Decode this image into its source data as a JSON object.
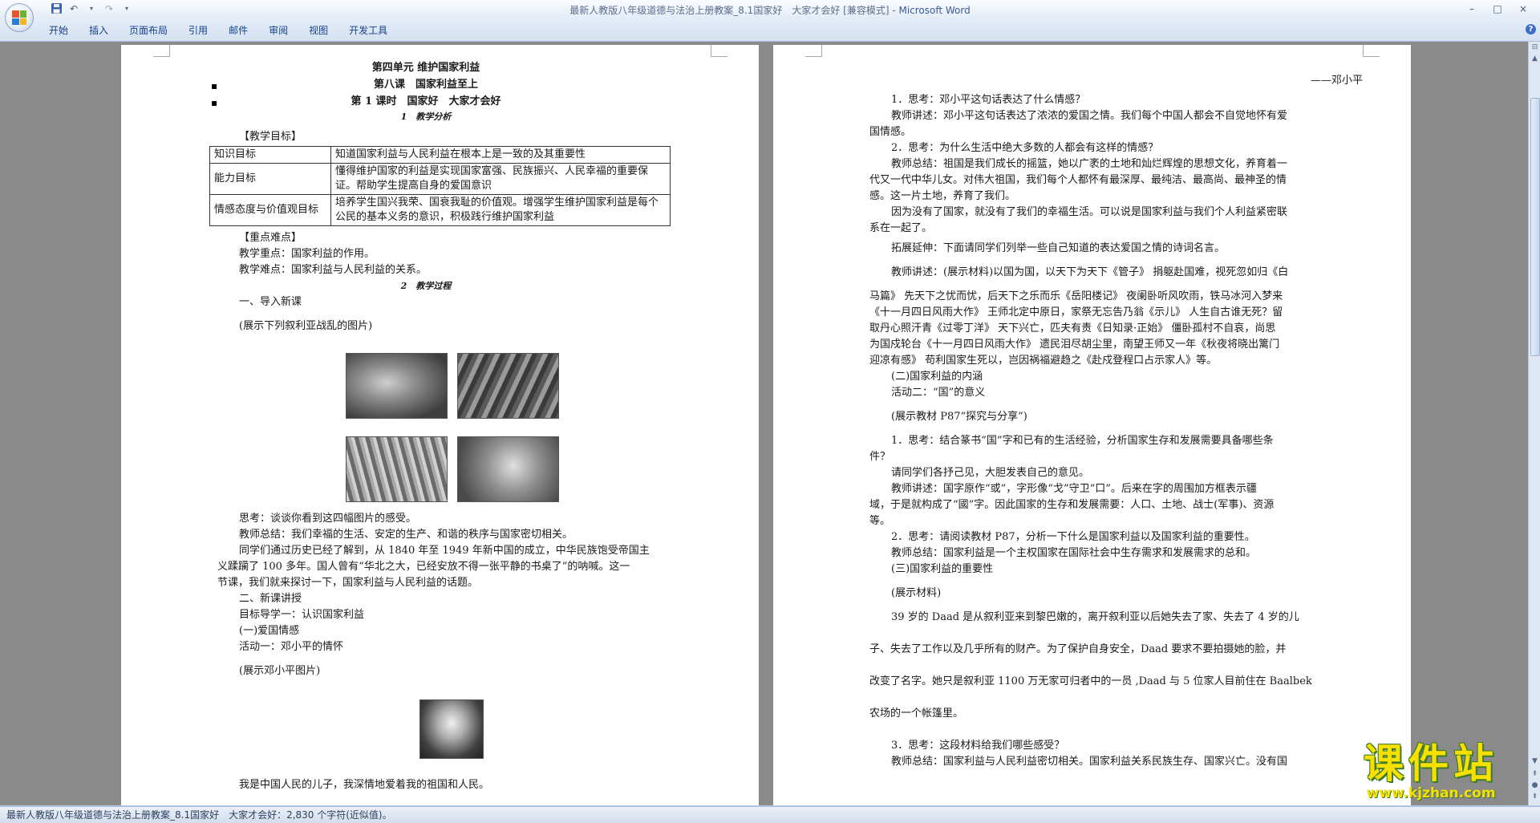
{
  "window": {
    "title": "最新人教版八年级道德与法治上册教案_8.1国家好　大家才会好 [兼容模式] - ",
    "app": "Microsoft Word",
    "controls": [
      "–",
      "□",
      "×"
    ]
  },
  "ribbon": {
    "tabs": [
      "开始",
      "插入",
      "页面布局",
      "引用",
      "邮件",
      "审阅",
      "视图",
      "开发工具"
    ],
    "help": "?"
  },
  "left_page": {
    "unit_title": "第四单元 维护国家利益",
    "lesson_title": "第八课　国家利益至上",
    "period_title": "第 1 课时　国家好　大家才会好",
    "section1": "1　教学分析",
    "goals_heading": "【教学目标】",
    "goals_table": [
      {
        "key": "知识目标",
        "value": "知道国家利益与人民利益在根本上是一致的及其重要性"
      },
      {
        "key": "能力目标",
        "value": "懂得维护国家的利益是实现国家富强、民族振兴、人民幸福的重要保证。帮助学生提高自身的爱国意识"
      },
      {
        "key": "情感态度与价值观目标",
        "value": "培养学生国兴我荣、国衰我耻的价值观。增强学生维护国家利益是每个公民的基本义务的意识，积极践行维护国家利益"
      }
    ],
    "key_heading": "【重点难点】",
    "key_point": "教学重点：国家利益的作用。",
    "difficult_point": "教学难点：国家利益与人民利益的关系。",
    "section2": "2　教学过程",
    "intro": "一、导入新课",
    "show_pics": "(展示下列叙利亚战乱的图片)",
    "think": "思考：谈谈你看到这四幅图片的感受。",
    "teacher_summary": "教师总结：我们幸福的生活、安定的生产、和谐的秩序与国家密切相关。",
    "para_lines": [
      "同学们通过历史已经了解到，从 1840 年至 1949 年新中国的成立，中华民族饱受帝国主",
      "义蹂躏了 100 多年。国人曾有“华北之大，已经安放不得一张平静的书桌了”的呐喊。这一",
      "节课，我们就来探讨一下，国家利益与人民利益的话题。"
    ],
    "new_lesson": "二、新课讲授",
    "goal_guide": "目标导学一：认识国家利益",
    "patriot": "(一)爱国情感",
    "activity1": "活动一：邓小平的情怀",
    "show_deng": "(展示邓小平图片)",
    "quote": "我是中国人民的儿子，我深情地爱着我的祖国和人民。"
  },
  "right_page": {
    "signature": "——邓小平",
    "lines": [
      "1．思考：邓小平这句话表达了什么情感？",
      "教师讲述：邓小平这句话表达了浓浓的爱国之情。我们每个中国人都会不自觉地怀有爱",
      "国情感。",
      "2．思考：为什么生活中绝大多数的人都会有这样的情感？",
      "教师总结：祖国是我们成长的摇篮，她以广袤的土地和灿烂辉煌的思想文化，养育着一",
      "代又一代中华儿女。对伟大祖国，我们每个人都怀有最深厚、最纯洁、最高尚、最神圣的情",
      "感。这一片土地，养育了我们。",
      "因为没有了国家，就没有了我们的幸福生活。可以说是国家利益与我们个人利益紧密联",
      "系在一起了。",
      "拓展延伸：下面请同学们列举一些自己知道的表达爱国之情的诗词名言。",
      "教师讲述：(展示材料)以国为国，以天下为天下《管子》 捐躯赴国难，视死忽如归《白",
      "马篇》 先天下之忧而忧，后天下之乐而乐《岳阳楼记》 夜阑卧听风吹雨，铁马冰河入梦来",
      "《十一月四日风雨大作》 王师北定中原日，家祭无忘告乃翁《示儿》 人生自古谁无死？留",
      "取丹心照汗青《过零丁洋》 天下兴亡，匹夫有责《日知录·正始》 僵卧孤村不自哀，尚思",
      "为国戍轮台《十一月四日风雨大作》 遗民泪尽胡尘里，南望王师又一年《秋夜将晓出篱门",
      "迎凉有感》 苟利国家生死以，岂因祸福避趋之《赴戍登程口占示家人》等。",
      "(二)国家利益的内涵",
      "活动二：“国”的意义",
      "(展示教材 P87“探究与分享”)",
      "1．思考：结合篆书“国”字和已有的生活经验，分析国家生存和发展需要具备哪些条",
      "件？",
      "请同学们各抒己见，大胆发表自己的意见。",
      "教师讲述：国字原作“或”，字形像“戈”守卫“口”。后来在字的周围加方框表示疆",
      "域，于是就构成了“國”字。因此国家的生存和发展需要：人口、土地、战士(军事)、资源",
      "等。",
      "2．思考：请阅读教材 P87，分析一下什么是国家利益以及国家利益的重要性。",
      "教师总结：国家利益是一个主权国家在国际社会中生存需求和发展需求的总和。",
      "(三)国家利益的重要性",
      "(展示材料)",
      "39 岁的 Daad 是从叙利亚来到黎巴嫩的，离开叙利亚以后她失去了家、失去了 4 岁的儿",
      "子、失去了工作以及几乎所有的财产。为了保护自身安全，Daad 要求不要拍摄她的脸，并",
      "改变了名字。她只是叙利亚 1100 万无家可归者中的一员 ,Daad 与 5 位家人目前住在 Baalbek",
      "农场的一个帐篷里。",
      "3．思考：这段材料给我们哪些感受？",
      "教师总结：国家利益与人民利益密切相关。国家利益关系民族生存、国家兴亡。没有国"
    ]
  },
  "statusbar": {
    "text": "最新人教版八年级道德与法治上册教案_8.1国家好　大家才会好：2,830 个字符(近似值)。"
  },
  "watermark": {
    "cn": "课件站",
    "url": "www.kjzhan.com"
  }
}
